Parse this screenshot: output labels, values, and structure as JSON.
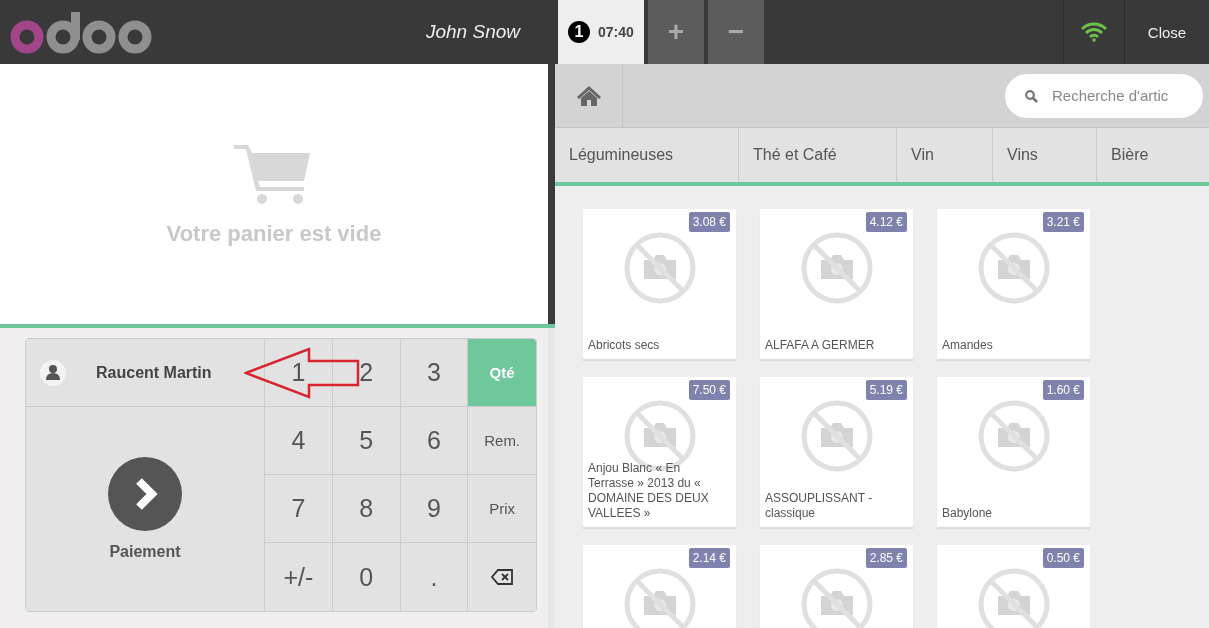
{
  "header": {
    "user": "John Snow",
    "orders": [
      {
        "number": "1",
        "time": "07:40",
        "selected": true
      }
    ],
    "add_label": "+",
    "remove_label": "−",
    "close": "Close"
  },
  "cart": {
    "empty_message": "Votre panier est vide"
  },
  "customer": {
    "name": "Raucent Martin"
  },
  "payment": {
    "label": "Paiement"
  },
  "numpad": [
    {
      "kind": "digit",
      "label": "1"
    },
    {
      "kind": "digit",
      "label": "2"
    },
    {
      "kind": "digit",
      "label": "3"
    },
    {
      "kind": "mode",
      "label": "Qté",
      "selected": true
    },
    {
      "kind": "digit",
      "label": "4"
    },
    {
      "kind": "digit",
      "label": "5"
    },
    {
      "kind": "digit",
      "label": "6"
    },
    {
      "kind": "mode",
      "label": "Rem.",
      "selected": false
    },
    {
      "kind": "digit",
      "label": "7"
    },
    {
      "kind": "digit",
      "label": "8"
    },
    {
      "kind": "digit",
      "label": "9"
    },
    {
      "kind": "mode",
      "label": "Prix",
      "selected": false
    },
    {
      "kind": "digit",
      "label": "+/-"
    },
    {
      "kind": "digit",
      "label": "0"
    },
    {
      "kind": "digit",
      "label": "."
    },
    {
      "kind": "backspace"
    }
  ],
  "search": {
    "placeholder": "Recherche d'artic"
  },
  "categories": [
    "Légumineuses",
    "Thé et Café",
    "Vin",
    "Vins",
    "Bière"
  ],
  "products": [
    {
      "name": "Abricots secs",
      "price": "3.08 €"
    },
    {
      "name": "ALFAFA A GERMER",
      "price": "4.12 €"
    },
    {
      "name": "Amandes",
      "price": "3.21 €"
    },
    {
      "name": "Anjou Blanc « En Terrasse » 2013 du « DOMAINE DES DEUX VALLEES »",
      "price": "7.50 €"
    },
    {
      "name": "ASSOUPLISSANT - classique",
      "price": "5.19 €"
    },
    {
      "name": "Babylone",
      "price": "1.60 €"
    },
    {
      "price": "2.14 €"
    },
    {
      "price": "2.85 €"
    },
    {
      "price": "0.50 €"
    }
  ]
}
